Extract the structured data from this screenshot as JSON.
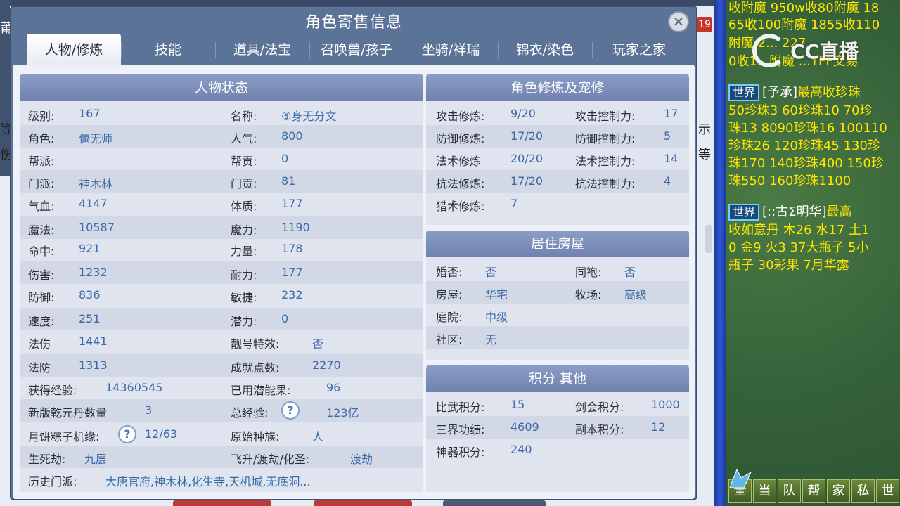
{
  "dialog": {
    "title": "角色寄售信息",
    "close_glyph": "✕"
  },
  "tabs": [
    {
      "label": "人物/修炼",
      "active": true
    },
    {
      "label": "技能"
    },
    {
      "label": "道具/法宝"
    },
    {
      "label": "召唤兽/孩子"
    },
    {
      "label": "坐骑/祥瑞"
    },
    {
      "label": "锦衣/染色"
    },
    {
      "label": "玩家之家"
    }
  ],
  "status_panel": {
    "title": "人物状态",
    "left": [
      {
        "label": "级别:",
        "value": "167"
      },
      {
        "label": "角色:",
        "value": "偃无师"
      },
      {
        "label": "帮派:",
        "value": ""
      },
      {
        "label": "门派:",
        "value": "神木林"
      },
      {
        "label": "气血:",
        "value": "4147"
      },
      {
        "label": "魔法:",
        "value": "10587"
      },
      {
        "label": "命中:",
        "value": "921"
      },
      {
        "label": "伤害:",
        "value": "1232"
      },
      {
        "label": "防御:",
        "value": "836"
      },
      {
        "label": "速度:",
        "value": "251"
      },
      {
        "label": "法伤",
        "value": "1441"
      },
      {
        "label": "法防",
        "value": "1313"
      },
      {
        "label": "获得经验:",
        "value": "14360545"
      },
      {
        "label": "新版乾元丹数量",
        "value": "3"
      },
      {
        "label": "月饼粽子机缘:",
        "value": "12/63",
        "help": "?"
      },
      {
        "label": "生死劫:",
        "value": "九层"
      },
      {
        "label": "历史门派:",
        "value": "大唐官府,神木林,化生寺,天机城,无底洞..."
      }
    ],
    "right": [
      {
        "label": "名称:",
        "value": "⑤身无分文"
      },
      {
        "label": "人气:",
        "value": "800"
      },
      {
        "label": "帮贡:",
        "value": "0"
      },
      {
        "label": "门贡:",
        "value": "81"
      },
      {
        "label": "体质:",
        "value": "177"
      },
      {
        "label": "魔力:",
        "value": "1190"
      },
      {
        "label": "力量:",
        "value": "178"
      },
      {
        "label": "耐力:",
        "value": "177"
      },
      {
        "label": "敏捷:",
        "value": "232"
      },
      {
        "label": "潜力:",
        "value": "0"
      },
      {
        "label": "靓号特效:",
        "value": "否"
      },
      {
        "label": "成就点数:",
        "value": "2270"
      },
      {
        "label": "已用潜能果:",
        "value": "96"
      },
      {
        "label": "总经验:",
        "value": "123亿",
        "help": "?"
      },
      {
        "label": "原始种族:",
        "value": "人"
      },
      {
        "label": "飞升/渡劫/化圣:",
        "value": "渡劫"
      }
    ]
  },
  "cultivation_panel": {
    "title": "角色修炼及宠修",
    "rows": [
      {
        "l1": "攻击修炼:",
        "v1": "9/20",
        "l2": "攻击控制力:",
        "v2": "17"
      },
      {
        "l1": "防御修炼:",
        "v1": "17/20",
        "l2": "防御控制力:",
        "v2": "5"
      },
      {
        "l1": "法术修炼",
        "v1": "20/20",
        "l2": "法术控制力:",
        "v2": "14"
      },
      {
        "l1": "抗法修炼:",
        "v1": "17/20",
        "l2": "抗法控制力:",
        "v2": "4"
      },
      {
        "l1": "猎术修炼:",
        "v1": "7",
        "l2": "",
        "v2": ""
      }
    ]
  },
  "house_panel": {
    "title": "居住房屋",
    "rows": [
      {
        "l1": "婚否:",
        "v1": "否",
        "l2": "同袍:",
        "v2": "否"
      },
      {
        "l1": "房屋:",
        "v1": "华宅",
        "l2": "牧场:",
        "v2": "高级"
      },
      {
        "l1": "庭院:",
        "v1": "中级",
        "l2": "",
        "v2": ""
      },
      {
        "l1": "社区:",
        "v1": "无",
        "l2": "",
        "v2": ""
      }
    ]
  },
  "points_panel": {
    "title": "积分 其他",
    "rows": [
      {
        "l1": "比武积分:",
        "v1": "15",
        "l2": "剑会积分:",
        "v2": "1000"
      },
      {
        "l1": "三界功绩:",
        "v1": "4609",
        "l2": "副本积分:",
        "v2": "12"
      },
      {
        "l1": "神器积分:",
        "v1": "240",
        "l2": "",
        "v2": ""
      }
    ]
  },
  "background": {
    "left_chars": [
      "莆",
      "等",
      "伤"
    ],
    "right_chars": [
      "示",
      "等"
    ],
    "badge": "19"
  },
  "chat": {
    "lines_top": [
      "收附魔 950w收80附魔 18",
      "65收100附魔 1855收110",
      "附魔 2... 227",
      "0收1...附魔 ...YFF交易"
    ],
    "msg1": {
      "channel": "世界",
      "speaker": "[予承]",
      "text": "最高收珍珠"
    },
    "msg1_lines": [
      " 50珍珠3 60珍珠10 70珍",
      "珠13 8090珍珠16 100110",
      "珍珠26 120珍珠45 130珍",
      "珠170 140珍珠400 150珍",
      "珠550 160珍珠1100"
    ],
    "msg2": {
      "channel": "世界",
      "speaker": "[::古Σ明华]",
      "text": "最高"
    },
    "msg2_lines": [
      "收如意丹 木26 水17 土1",
      "0 金9 火3 37大瓶子 5小",
      "瓶子 30彩果 7月华露"
    ],
    "watermark": "CC直播",
    "bottom_buttons": [
      "全",
      "当",
      "队",
      "帮",
      "家",
      "私",
      "世"
    ]
  }
}
